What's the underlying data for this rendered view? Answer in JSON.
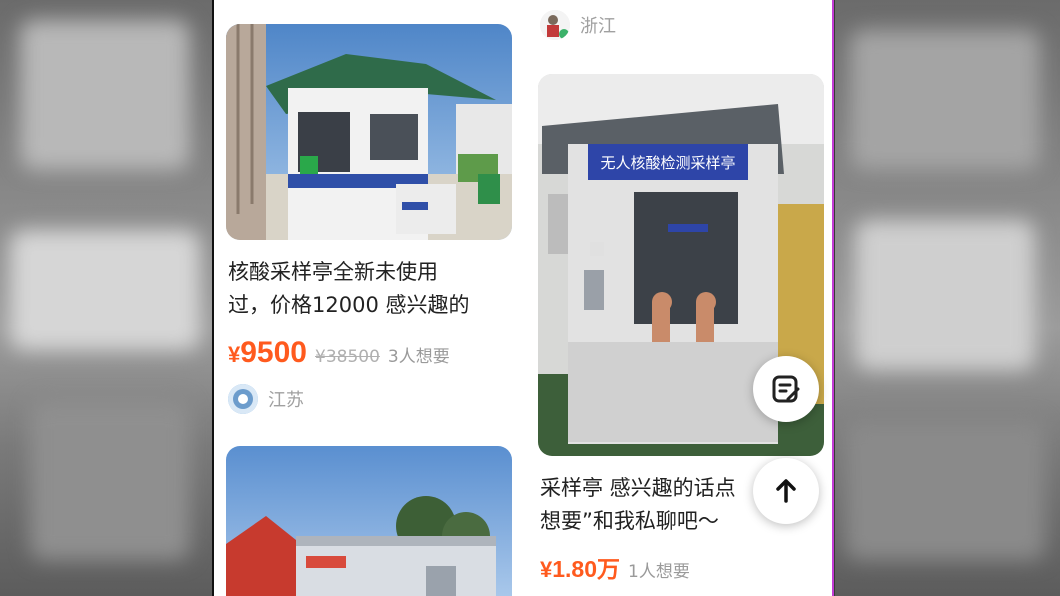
{
  "feed": {
    "items": [
      {
        "title": "核酸采样亭全新未使用\n过，价格12000 感兴趣的",
        "price_symbol": "¥",
        "price": "9500",
        "original_price": "¥38500",
        "wants": "3人想要",
        "location": "江苏"
      },
      {
        "title": "采样亭 感兴趣的话点\n想要”和我私聊吧～",
        "price_symbol": "¥",
        "price": "1.80万",
        "wants": "1人想要",
        "location": "浙江",
        "booth_sign": "无人核酸检测采样亭"
      }
    ]
  },
  "icons": {
    "note": "note-edit-icon",
    "top": "arrow-up-icon"
  },
  "colors": {
    "price": "#ff5a1e",
    "screen_bg": "#ffffff"
  }
}
